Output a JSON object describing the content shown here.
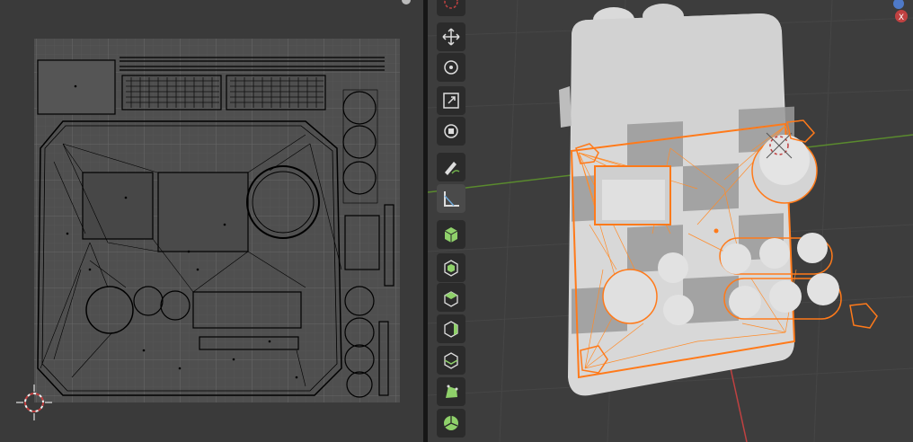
{
  "uv_editor": {
    "cursor_icon": "2d-cursor-icon",
    "grid_icon": "uv-grid"
  },
  "toolbar": {
    "tools": [
      {
        "name": "cursor-tool",
        "icon": "cursor-icon"
      },
      {
        "name": "move-tool",
        "icon": "move-arrows-icon"
      },
      {
        "name": "rotate-tool",
        "icon": "rotate-icon"
      },
      {
        "name": "scale-tool",
        "icon": "scale-icon"
      },
      {
        "name": "transform-tool",
        "icon": "transform-icon"
      },
      {
        "name": "annotate-tool",
        "icon": "annotate-pen-icon"
      },
      {
        "name": "measure-tool",
        "icon": "measure-ruler-icon"
      },
      {
        "name": "add-cube-tool",
        "icon": "add-cube-icon"
      },
      {
        "name": "extrude-tool",
        "icon": "extrude-icon"
      },
      {
        "name": "inset-faces-tool",
        "icon": "inset-icon"
      },
      {
        "name": "bevel-tool",
        "icon": "bevel-icon"
      },
      {
        "name": "loop-cut-tool",
        "icon": "loop-cut-icon"
      },
      {
        "name": "knife-tool",
        "icon": "knife-icon"
      },
      {
        "name": "poly-build-tool",
        "icon": "poly-build-icon"
      },
      {
        "name": "spin-tool",
        "icon": "spin-icon"
      }
    ]
  },
  "viewport": {
    "gizmo_label": "X",
    "colors": {
      "selection": "#ff7a1a",
      "axis_red": "#c04141",
      "axis_green": "#5a8a2e",
      "mesh": "#d6d6d6"
    }
  }
}
